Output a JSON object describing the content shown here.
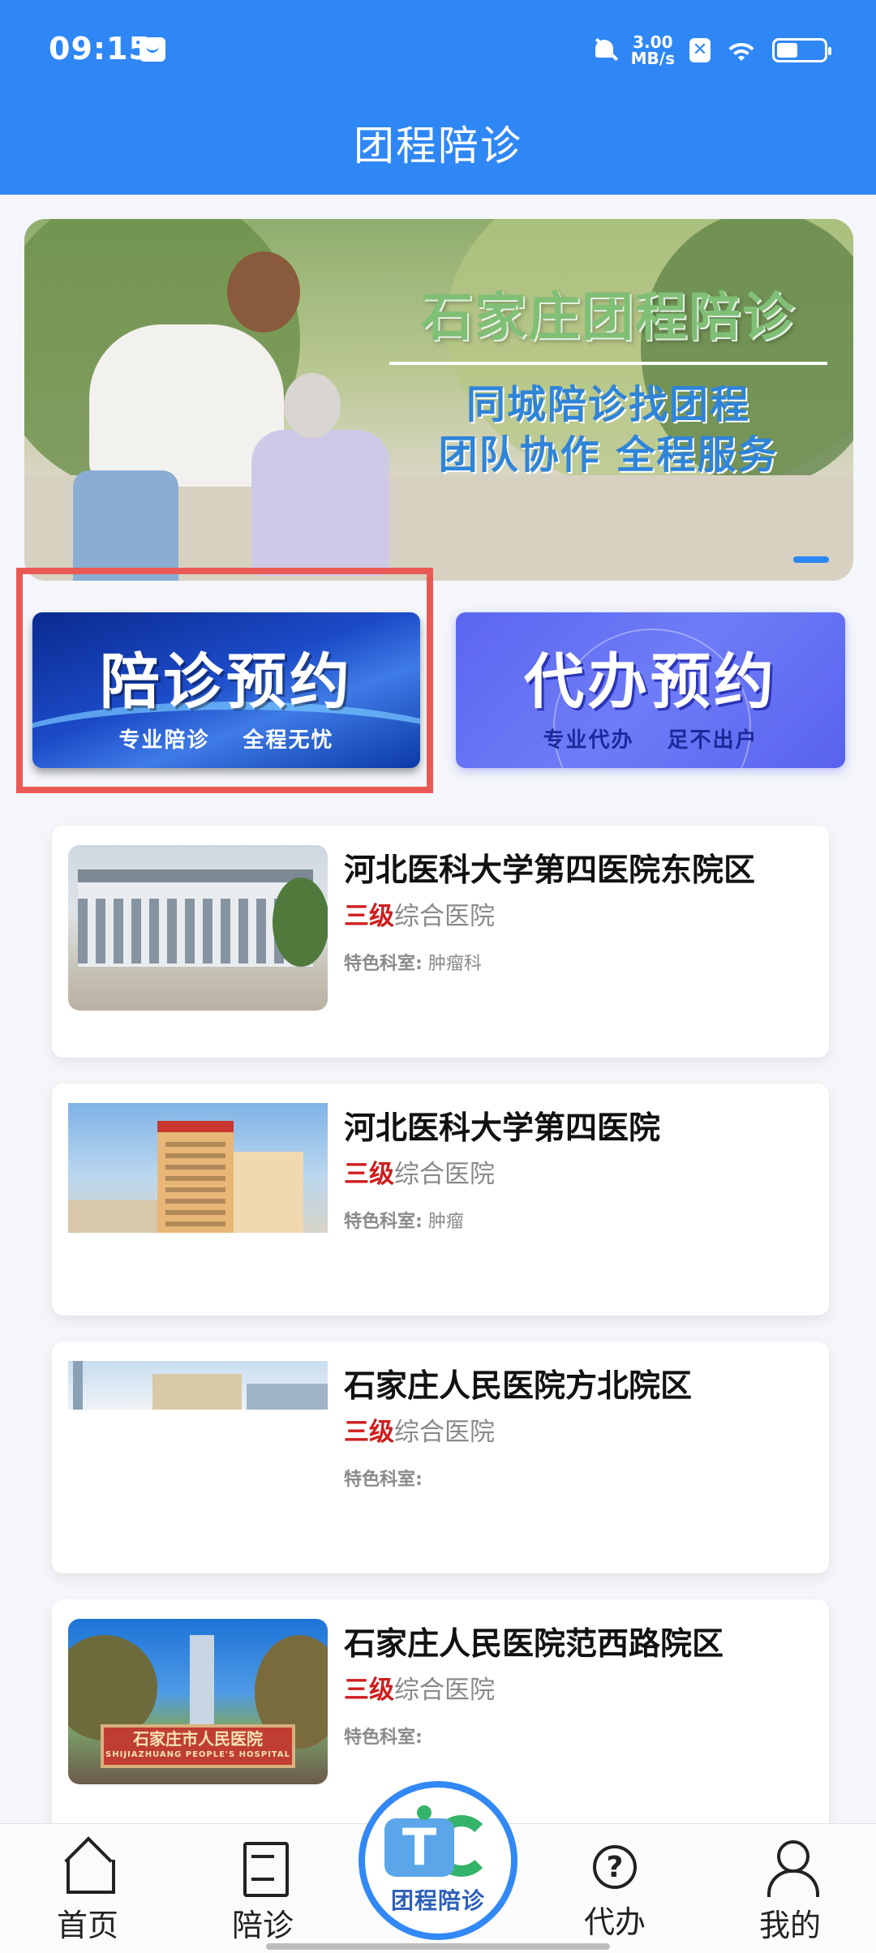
{
  "status_bar": {
    "time": "09:15",
    "net_speed_value": "3.00",
    "net_speed_unit": "MB/s",
    "x_badge": "✕",
    "battery_level": 0.45
  },
  "header": {
    "title": "团程陪诊"
  },
  "banner": {
    "main": "石家庄团程陪诊",
    "line1": "同城陪诊找团程",
    "line2": "团队协作 全程服务"
  },
  "services": [
    {
      "title": "陪诊预约",
      "subtitle": "专业陪诊 全程无忧"
    },
    {
      "title": "代办预约",
      "subtitle": "专业代办 足不出户"
    }
  ],
  "hospitals": [
    {
      "name": "河北医科大学第四医院东院区",
      "level": "三级",
      "type": "综合医院",
      "dept_label": "特色科室:",
      "dept": "肿瘤科"
    },
    {
      "name": "河北医科大学第四医院",
      "level": "三级",
      "type": "综合医院",
      "dept_label": "特色科室:",
      "dept": "肿瘤"
    },
    {
      "name": "石家庄人民医院方北院区",
      "level": "三级",
      "type": "综合医院",
      "dept_label": "特色科室:",
      "dept": ""
    },
    {
      "name": "石家庄人民医院范西路院区",
      "level": "三级",
      "type": "综合医院",
      "dept_label": "特色科室:",
      "dept": ""
    }
  ],
  "img4_sign": {
    "cn": "石家庄市人民医院",
    "en": "SHIJIAZHUANG PEOPLE'S HOSPITAL"
  },
  "bottom_nav": {
    "home": "首页",
    "escort": "陪诊",
    "agent": "代办",
    "mine": "我的",
    "center_logo_letter": "T",
    "center_logo_text": "团程陪诊"
  },
  "colors": {
    "brand_blue": "#2f87f5",
    "highlight_red": "#ea5a55",
    "level_red": "#d01d1d"
  }
}
